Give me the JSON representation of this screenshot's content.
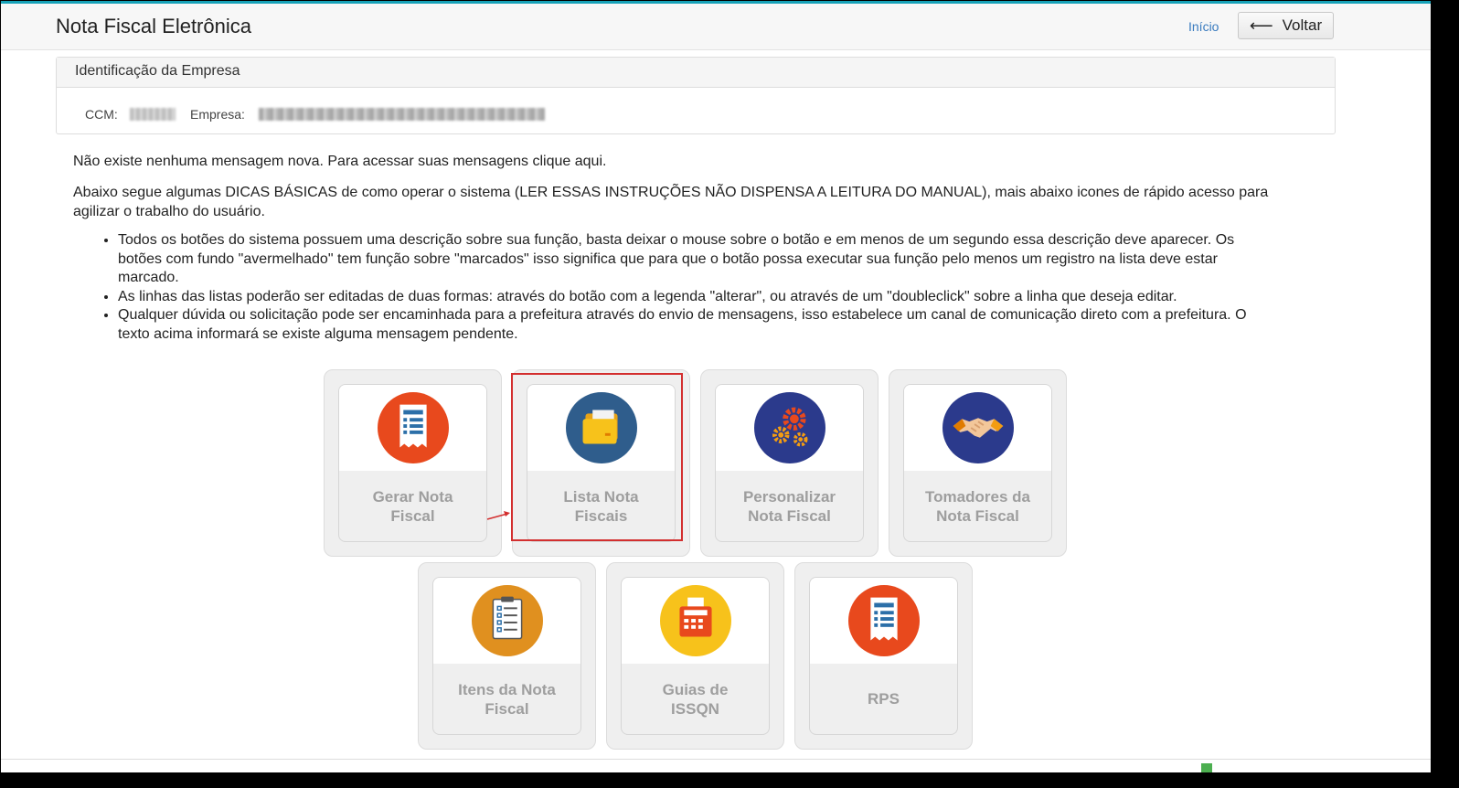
{
  "header": {
    "title": "Nota Fiscal Eletrônica",
    "inicio_label": "Início",
    "back_label": "Voltar"
  },
  "company_panel": {
    "title": "Identificação da Empresa",
    "ccm_label": "CCM:",
    "empresa_label": "Empresa:"
  },
  "content": {
    "message_text": "Não existe nenhuma mensagem nova. Para acessar suas mensagens clique aqui.",
    "intro_text": "Abaixo segue algumas DICAS BÁSICAS de como operar o sistema (LER ESSAS INSTRUÇÕES NÃO DISPENSA A LEITURA DO MANUAL), mais abaixo icones de rápido acesso para agilizar o trabalho do usuário.",
    "tips": [
      "Todos os botões do sistema possuem uma descrição sobre sua função, basta deixar o mouse sobre o botão e em menos de um segundo essa descrição deve aparecer. Os botões com fundo \"avermelhado\" tem função sobre \"marcados\" isso significa que para que o botão possa executar sua função pelo menos um registro na lista deve estar marcado.",
      "As linhas das listas poderão ser editadas de duas formas: através do botão com a legenda \"alterar\", ou através de um \"doubleclick\" sobre a linha que deseja editar.",
      "Qualquer dúvida ou solicitação pode ser encaminhada para a prefeitura através do envio de mensagens, isso estabelece um canal de comunicação direto com a prefeitura. O texto acima informará se existe alguma mensagem pendente."
    ]
  },
  "tiles": [
    {
      "label": "Gerar Nota Fiscal",
      "icon": "receipt-icon"
    },
    {
      "label": "Lista Nota Fiscais",
      "icon": "folder-icon"
    },
    {
      "label": "Personalizar Nota Fiscal",
      "icon": "gears-icon"
    },
    {
      "label": "Tomadores da Nota Fiscal",
      "icon": "handshake-icon"
    },
    {
      "label": "Itens da Nota Fiscal",
      "icon": "clipboard-icon"
    },
    {
      "label": "Guias de ISSQN",
      "icon": "cash-register-icon"
    },
    {
      "label": "RPS",
      "icon": "receipt-icon"
    }
  ],
  "colors": {
    "accent_top_border": "#17a2b8",
    "highlight_border": "#d32f2f",
    "tile_label": "#9e9e9e",
    "link": "#3a7bbf"
  }
}
